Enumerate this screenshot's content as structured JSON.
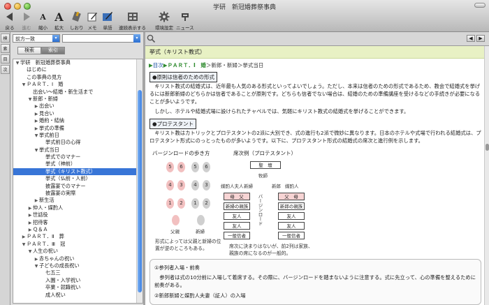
{
  "window": {
    "title": "学研　新冠婚葬祭事典"
  },
  "toolbar": {
    "items": [
      {
        "label": "戻る",
        "icon": "back-arrow-icon"
      },
      {
        "label": "進む",
        "icon": "forward-arrow-icon"
      },
      {
        "label": "縮小",
        "icon": "font-smaller-icon"
      },
      {
        "label": "拡大",
        "icon": "font-larger-icon"
      },
      {
        "label": "しおり",
        "icon": "bookmark-icon"
      },
      {
        "label": "メモ",
        "icon": "memo-icon"
      },
      {
        "label": "単語",
        "icon": "word-icon"
      },
      {
        "label": "連続表示する",
        "icon": "continuous-display-icon"
      },
      {
        "label": "環境設定",
        "icon": "gear-icon"
      },
      {
        "label": "ニュース",
        "icon": "news-icon"
      }
    ]
  },
  "side_tabs": [
    "検",
    "索",
    "目",
    "次"
  ],
  "search": {
    "mode": "前方一致",
    "value": "",
    "tabs": [
      "検索",
      "索引"
    ],
    "active_tab": "索引"
  },
  "tree": [
    {
      "label": "学研　新冠婚葬祭事典",
      "indent": 0,
      "arrow": "down"
    },
    {
      "label": "はじめに",
      "indent": 1,
      "arrow": ""
    },
    {
      "label": "この事典の見方",
      "indent": 1,
      "arrow": ""
    },
    {
      "label": "ＰＡＲＴ．Ⅰ　婚",
      "indent": 1,
      "arrow": "down"
    },
    {
      "label": "出会い～結婚・新生活まで",
      "indent": 2,
      "arrow": ""
    },
    {
      "label": "新郎・新婦",
      "indent": 2,
      "arrow": "down"
    },
    {
      "label": "出会い",
      "indent": 3,
      "arrow": "right"
    },
    {
      "label": "見合い",
      "indent": 3,
      "arrow": "right"
    },
    {
      "label": "婚約・結納",
      "indent": 3,
      "arrow": "right"
    },
    {
      "label": "挙式の準備",
      "indent": 3,
      "arrow": "right"
    },
    {
      "label": "挙式前日",
      "indent": 3,
      "arrow": "down"
    },
    {
      "label": "挙式前日の心得",
      "indent": 4,
      "arrow": ""
    },
    {
      "label": "挙式当日",
      "indent": 3,
      "arrow": "down"
    },
    {
      "label": "挙式でのマナー",
      "indent": 4,
      "arrow": ""
    },
    {
      "label": "挙式（神前）",
      "indent": 4,
      "arrow": ""
    },
    {
      "label": "挙式（キリスト教式）",
      "indent": 4,
      "arrow": "",
      "selected": true
    },
    {
      "label": "挙式（仏前・人前）",
      "indent": 4,
      "arrow": ""
    },
    {
      "label": "披露宴でのマナー",
      "indent": 4,
      "arrow": ""
    },
    {
      "label": "披露宴の実際",
      "indent": 4,
      "arrow": ""
    },
    {
      "label": "新生活",
      "indent": 3,
      "arrow": "right"
    },
    {
      "label": "仲人・媒酌人",
      "indent": 2,
      "arrow": "right"
    },
    {
      "label": "世話役",
      "indent": 2,
      "arrow": "right"
    },
    {
      "label": "招待客",
      "indent": 2,
      "arrow": "right"
    },
    {
      "label": "Ｑ＆Ａ",
      "indent": 2,
      "arrow": "right"
    },
    {
      "label": "ＰＡＲＴ．Ⅱ　葬",
      "indent": 1,
      "arrow": "right"
    },
    {
      "label": "ＰＡＲＴ．Ⅲ　冠",
      "indent": 1,
      "arrow": "down"
    },
    {
      "label": "人生の祝い",
      "indent": 2,
      "arrow": "down"
    },
    {
      "label": "赤ちゃんの祝い",
      "indent": 3,
      "arrow": "right"
    },
    {
      "label": "子どもの成長祝い",
      "indent": 3,
      "arrow": "down"
    },
    {
      "label": "七五三",
      "indent": 4,
      "arrow": ""
    },
    {
      "label": "入園・入学祝い",
      "indent": 4,
      "arrow": ""
    },
    {
      "label": "卒業・就職祝い",
      "indent": 4,
      "arrow": ""
    },
    {
      "label": "成人祝い",
      "indent": 4,
      "arrow": ""
    }
  ],
  "entry": {
    "title": "挙式（キリスト教式）",
    "breadcrumb": {
      "root": "目次",
      "part": "ＰＡＲＴ．Ⅰ　婚",
      "path": "＞新郎・新婦＞挙式当日"
    },
    "section1_label": "●原則は信者のための形式",
    "para1": "キリスト教式の結婚式は、近年最も人気のある形式といってよいでしょう。ただし、本来は信者のための形式であるため、教会で結婚式を挙げるには新郎新婦のどちらかは信者であることが原則です。どちらも信者でない場合は、結婚のための準備講座を受けるなどの手続きが必要になることが多いようです。",
    "para2": "しかし、ホテルや結婚式場に設けられたチャペルでは、気軽にキリスト教式の結婚式を挙げることができます。",
    "section2_label": "●プロテスタント",
    "para3": "キリスト教はカトリックとプロテスタントの2派に大別でき、式の進行も2派で微妙に異なります。日本のホテルや式場で行われる結婚式は、プロテスタント形式にのっとったものが多いようです。以下に、プロテスタント形式の結婚式の席次と進行例を示します。",
    "figure": {
      "left_title": "バージンロードの歩き方",
      "left_pink": [
        "5",
        "4",
        "1"
      ],
      "left_pink2": [
        "6",
        "3",
        "2"
      ],
      "left_grey": [
        "5",
        "4",
        "1"
      ],
      "left_grey2": [
        "6",
        "3",
        "2"
      ],
      "father_label": "父親",
      "groom_label": "新婦",
      "left_caption": "形式によっては父親と新婦の位置が逆のところもある。",
      "right_title": "席次例（プロテスタント）",
      "altar": "聖　壇",
      "pastor": "牧師",
      "bride_side": "媒酌人夫人",
      "bride": "新婦",
      "groom": "新郎",
      "groom_side": "媒酌人",
      "virgin_road": "バージンロード",
      "left_rows": [
        "母　父",
        "新婦の親族",
        "友人",
        "友人",
        "一般信者"
      ],
      "right_rows": [
        "父　母",
        "新郎の親族",
        "友人",
        "友人",
        "一般信者"
      ],
      "right_caption": "席次に決まりはないが、前2列は家族、親族の席になるのが一般的。"
    },
    "note1_title": "①参列者入場・前奏",
    "note1_body": "参列者は式の10分前に入場して着席する。その際に、バージンロードを踏まないように注意する。式に先立って、心の準備を整えるために前奏がある。",
    "note2_title": "②新郎新婦と媒酌人夫妻（証人）の入場"
  }
}
